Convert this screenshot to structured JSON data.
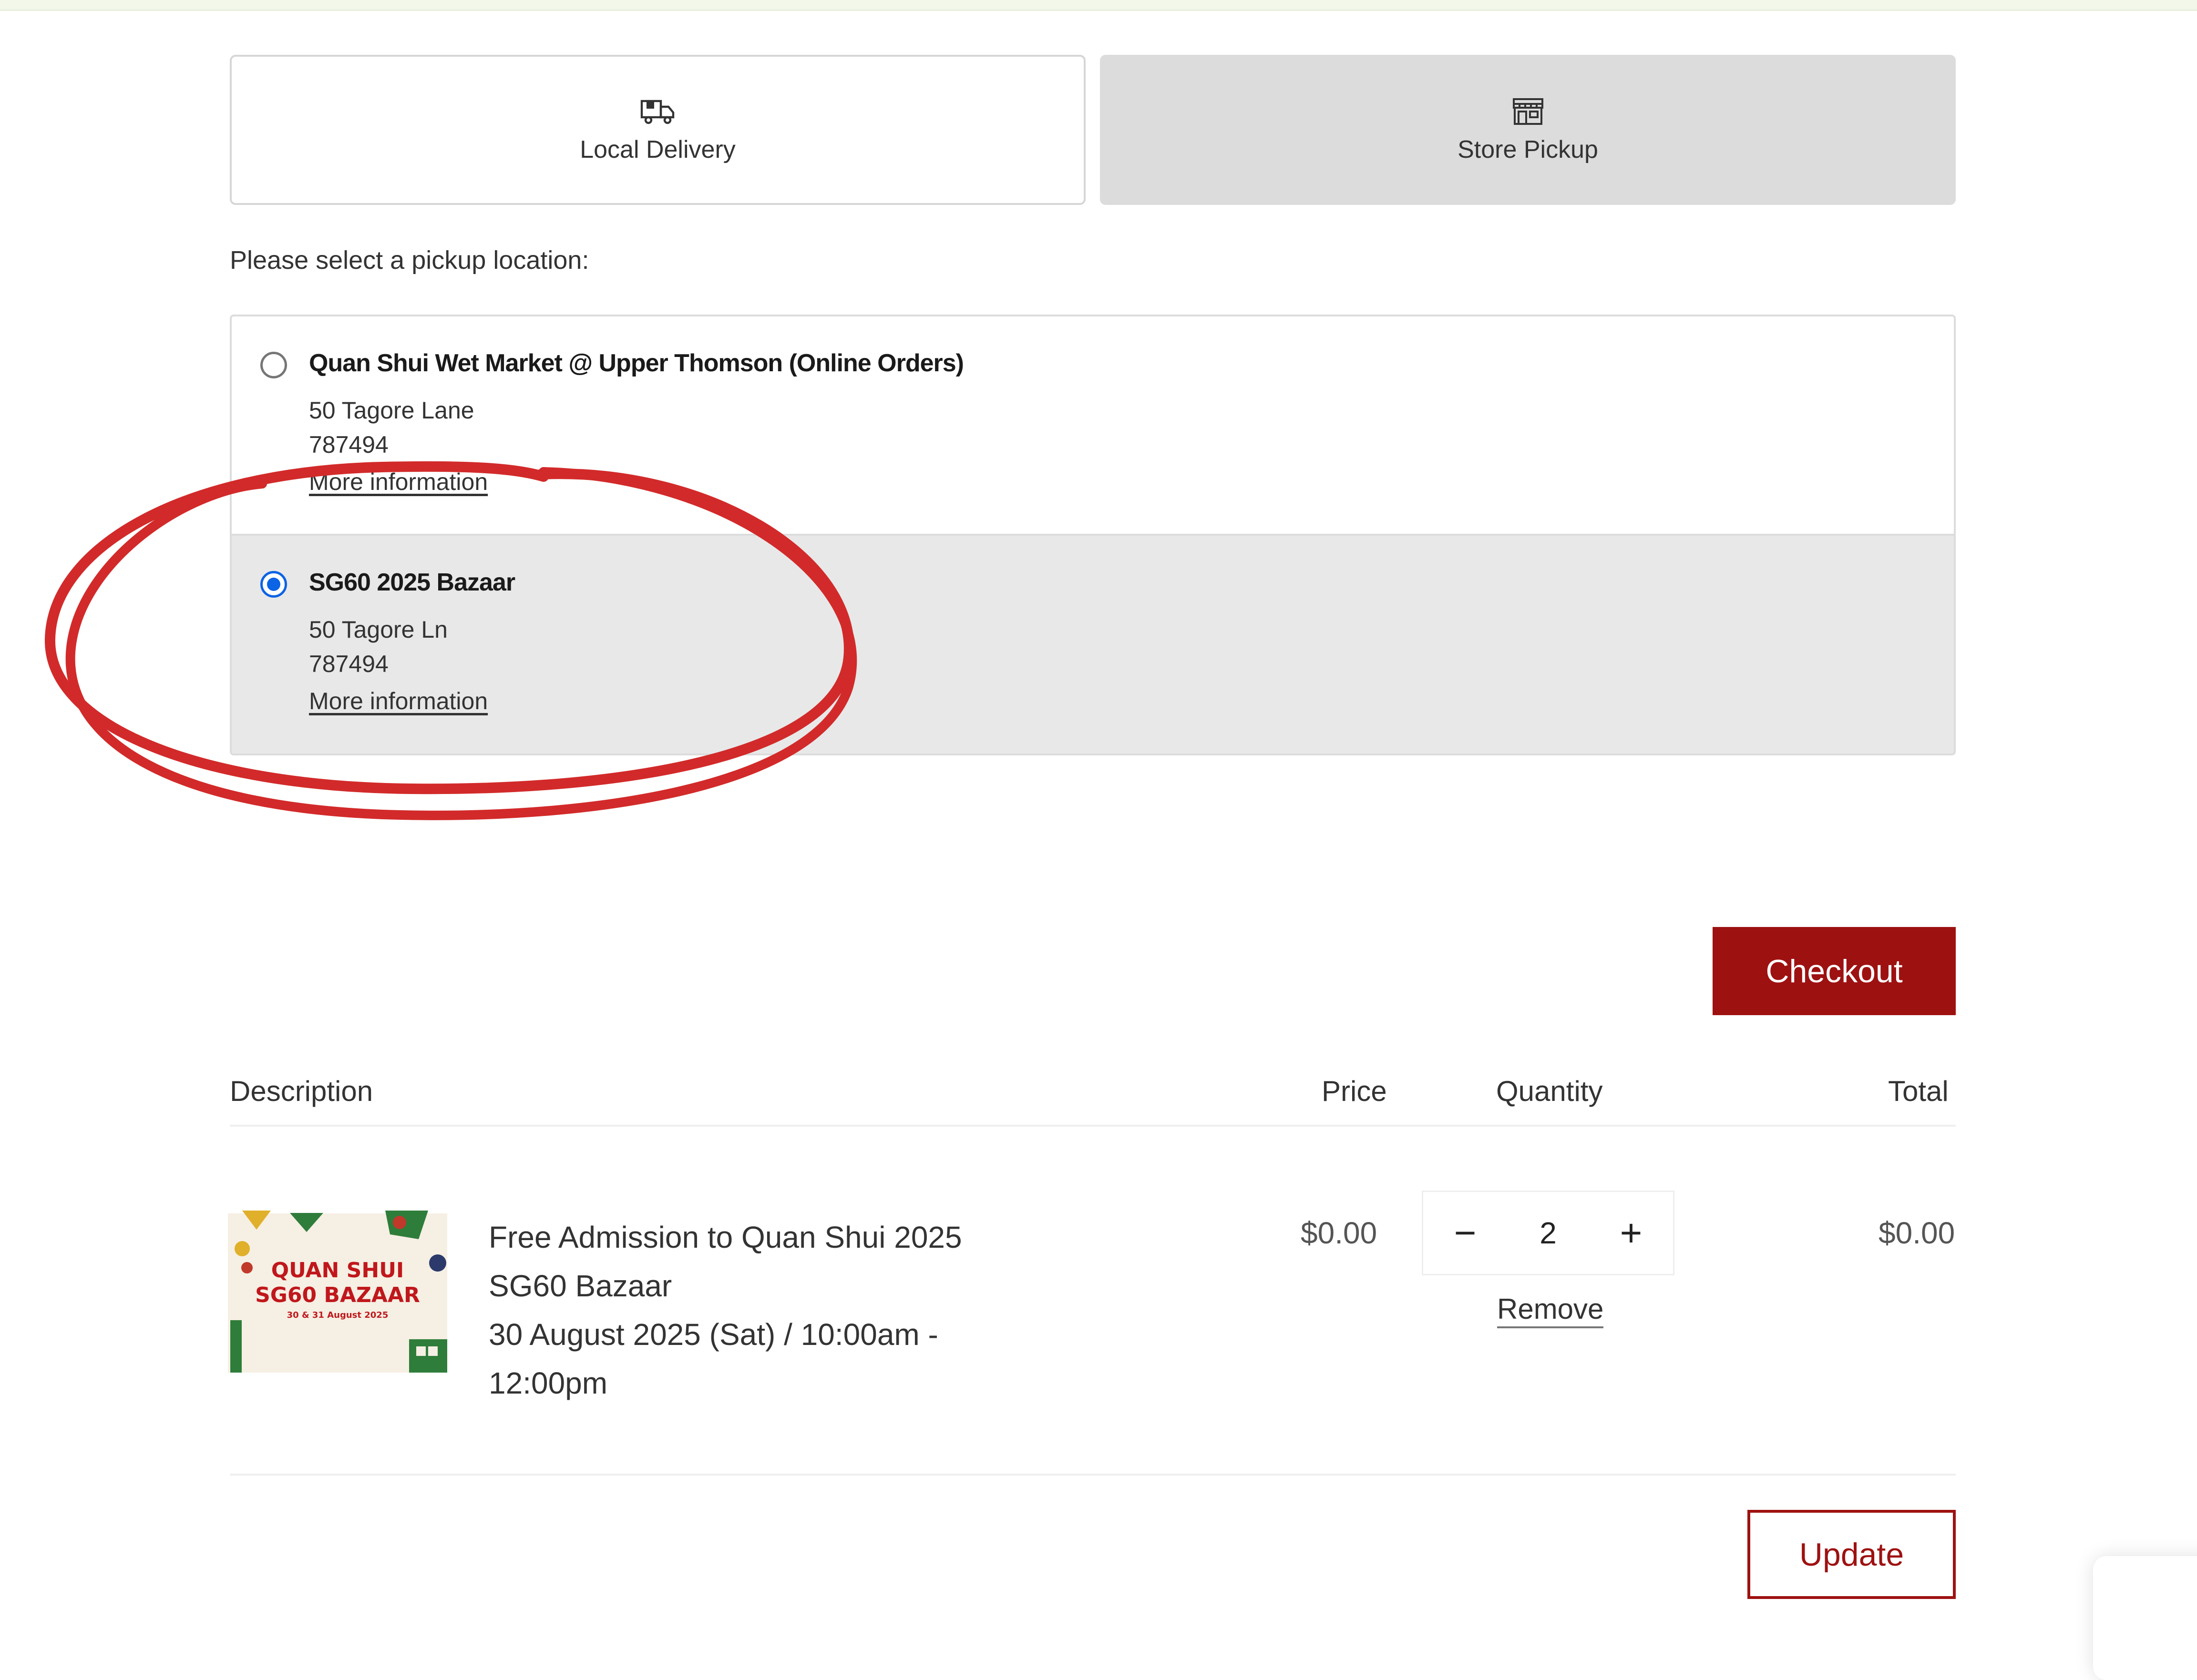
{
  "delivery_methods": [
    {
      "label": "Local Delivery",
      "icon": "delivery-truck-icon",
      "selected": false
    },
    {
      "label": "Store Pickup",
      "icon": "storefront-icon",
      "selected": true
    }
  ],
  "pickup_prompt": "Please select a pickup location:",
  "locations": [
    {
      "name": "Quan Shui Wet Market @ Upper Thomson (Online Orders)",
      "street": "50 Tagore Lane",
      "postal": "787494",
      "link": "More information",
      "selected": false
    },
    {
      "name": "SG60 2025 Bazaar",
      "street": "50 Tagore Ln",
      "postal": "787494",
      "link": "More information",
      "selected": true
    }
  ],
  "checkout_label": "Checkout",
  "cart": {
    "headers": {
      "description": "Description",
      "price": "Price",
      "quantity": "Quantity",
      "total": "Total"
    },
    "items": [
      {
        "thumb_lines": [
          "QUAN SHUI",
          "SG60 BAZAAR",
          "30 & 31 August 2025"
        ],
        "title": "Free Admission to Quan Shui 2025 SG60 Bazaar",
        "variant": "30 August 2025 (Sat) / 10:00am - 12:00pm",
        "price": "$0.00",
        "quantity": "2",
        "remove_label": "Remove",
        "total": "$0.00"
      }
    ]
  },
  "qty_minus": "−",
  "qty_plus": "+",
  "update_label": "Update",
  "colors": {
    "brand_red": "#9e1111",
    "radio_blue": "#0b63e5",
    "annotation_red": "#d22a2a"
  }
}
